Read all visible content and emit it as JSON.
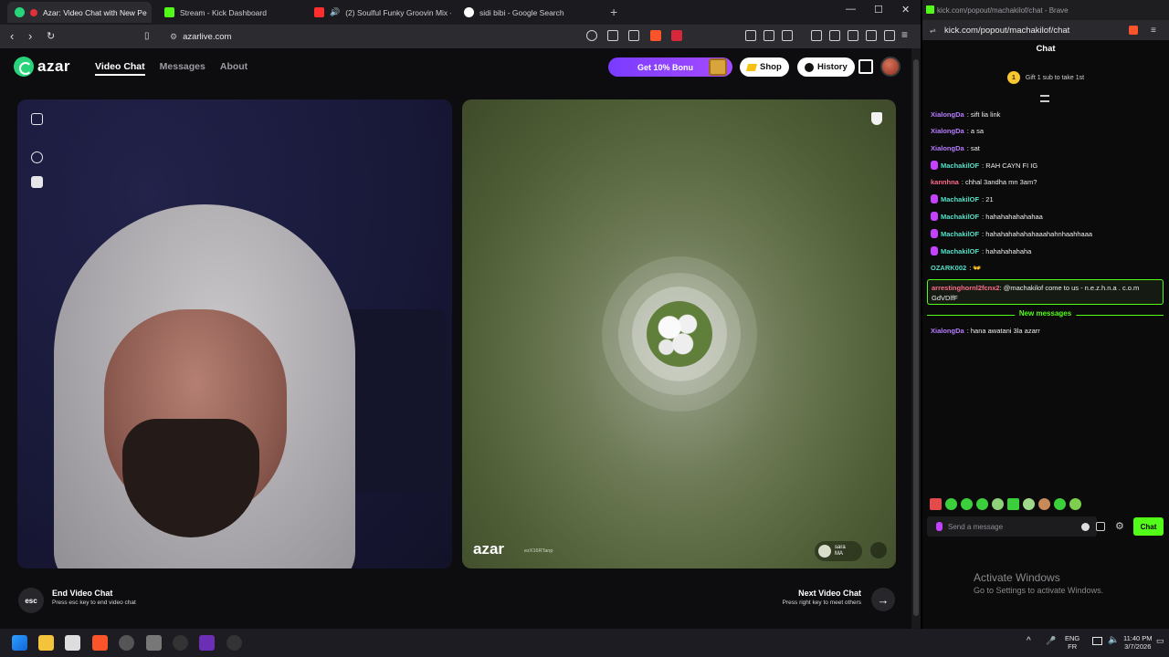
{
  "browser": {
    "tabs": [
      {
        "label": "Azar: Video Chat with New Pe",
        "active": true
      },
      {
        "label": "Stream - Kick Dashboard"
      },
      {
        "label": "(2) Soulful Funky Groovin Mix - F"
      },
      {
        "label": "sidi bibi - Google Search"
      }
    ],
    "url": "azarlive.com"
  },
  "azar": {
    "logo": "azar",
    "nav": [
      "Video Chat",
      "Messages",
      "About"
    ],
    "promo_label": "Get 10% Bonu",
    "shop_label": "Shop",
    "history_label": "History",
    "partner": {
      "name": "sara",
      "country": "MA"
    },
    "watermark": "azar",
    "watermark_id": "ezX16RTanp",
    "end": {
      "title": "End Video Chat",
      "subtitle": "Press esc key to end video chat",
      "key": "esc"
    },
    "next": {
      "title": "Next Video Chat",
      "subtitle": "Press right key to meet others"
    }
  },
  "chat": {
    "window_title": "kick.com/popout/machakilof/chat - Brave",
    "url": "kick.com/popout/machakilof/chat",
    "header": "Chat",
    "gift_text": "Gift 1 sub to take 1st",
    "gift_rank": "1",
    "messages": [
      {
        "user": "XialongDa",
        "color": "#b77cff",
        "text": ": sift lia link",
        "mic": false
      },
      {
        "user": "XialongDa",
        "color": "#b77cff",
        "text": ": a sa",
        "mic": false
      },
      {
        "user": "XialongDa",
        "color": "#b77cff",
        "text": ": sat",
        "mic": false
      },
      {
        "user": "MachakilOF",
        "color": "#53e0c8",
        "text": ": RAH CAYN FI IG",
        "mic": true
      },
      {
        "user": "kannhna",
        "color": "#ff6b8a",
        "text": ": chhal 3andha mn 3am?",
        "mic": false
      },
      {
        "user": "MachakilOF",
        "color": "#53e0c8",
        "text": ": 21",
        "mic": true
      },
      {
        "user": "MachakilOF",
        "color": "#53e0c8",
        "text": ": hahahahahahahaa",
        "mic": true
      },
      {
        "user": "MachakilOF",
        "color": "#53e0c8",
        "text": ": hahahahahahahaaahahnhaahhaaa",
        "mic": true
      },
      {
        "user": "MachakilOF",
        "color": "#53e0c8",
        "text": ": hahahahahaha",
        "mic": true
      },
      {
        "user": "OZARK002",
        "color": "#53e0c8",
        "text": ": 👐",
        "mic": false
      }
    ],
    "highlight": {
      "user": "arrestinghornl2fcnx2",
      "color": "#ff6b8a",
      "text": ": @machakilof come to us - n.e.z.h.n.a . c.o.m GdVDlfF"
    },
    "new_messages_label": "New messages",
    "after": {
      "user": "XialongDa",
      "color": "#b77cff",
      "text": ": hana awatani 3la azarr"
    },
    "input_placeholder": "Send a message",
    "send_label": "Chat"
  },
  "windows": {
    "activate_title": "Activate Windows",
    "activate_sub": "Go to Settings to activate Windows.",
    "lang_top": "ENG",
    "lang_bottom": "FR",
    "time": "11:40 PM",
    "date": "3/7/2026"
  },
  "colors": {
    "azar_green": "#27d47a",
    "kick_green": "#53fc18",
    "promo_purple": "#8b3fff"
  }
}
